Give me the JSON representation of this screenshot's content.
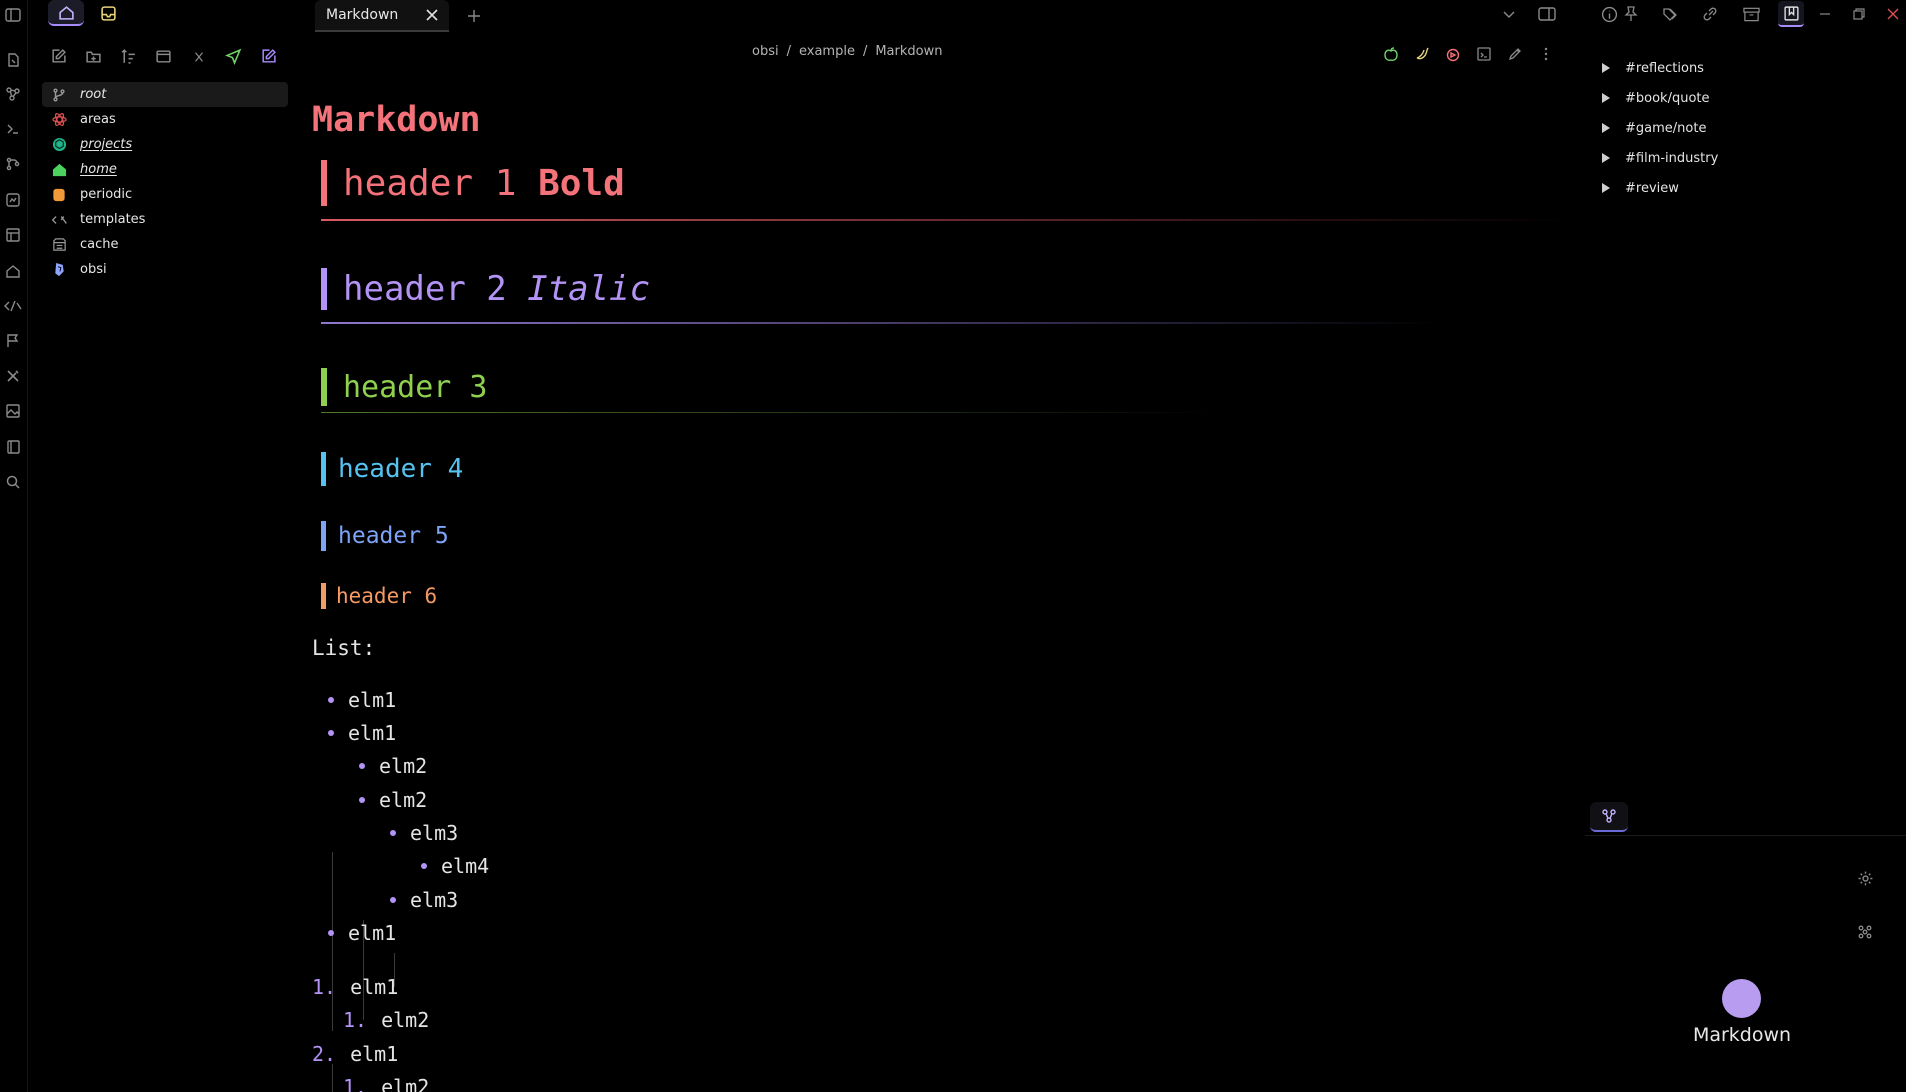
{
  "ribbon": {
    "icons": [
      "sidebar-toggle-icon",
      "open-quick-switcher-icon",
      "graph-view-icon",
      "terminal-icon",
      "git-icon",
      "canvas-icon",
      "templates-icon",
      "home-icon",
      "templater-icon",
      "flag-icon",
      "tools-icon",
      "image-icon",
      "book-icon",
      "search-icon"
    ]
  },
  "sidebar": {
    "tabs": [
      "home-icon",
      "inbox-icon"
    ],
    "toolbar": [
      "new-note-icon",
      "new-folder-icon",
      "sort-icon",
      "collapse-all-icon",
      "close-icon",
      "send-icon",
      "edit-note-icon"
    ],
    "tree": [
      {
        "label": "root",
        "icon": "git-branch-icon",
        "color": "#9a9a9a"
      },
      {
        "label": "areas",
        "icon": "atom-icon",
        "color": "#e0504f"
      },
      {
        "label": "projects",
        "icon": "cube-icon",
        "color": "#21b38a"
      },
      {
        "label": "home",
        "icon": "home-icon",
        "color": "#4cd35f"
      },
      {
        "label": "periodic",
        "icon": "calendar-icon",
        "color": "#f29a3a"
      },
      {
        "label": "templates",
        "icon": "code-icon",
        "color": "#9a9a9a"
      },
      {
        "label": "cache",
        "icon": "archive-icon",
        "color": "#9a9a9a"
      },
      {
        "label": "obsi",
        "icon": "obsidian-icon",
        "color": "#8ea4ff"
      }
    ]
  },
  "tabs": {
    "active_label": "Markdown",
    "close_label": "✕",
    "new_tab_label": "+"
  },
  "breadcrumb": {
    "parts": [
      "obsi",
      "/",
      "example",
      "/",
      "Markdown"
    ]
  },
  "note": {
    "title": "Markdown",
    "h1": {
      "text": "header 1 ",
      "bold": "Bold",
      "color": "#f4727a"
    },
    "h2": {
      "text": "header 2 ",
      "italic": "Italic",
      "color": "#b393f5"
    },
    "h3": {
      "text": "header 3",
      "color": "#8fd14f"
    },
    "h4": {
      "text": "header 4",
      "color": "#56c2f0"
    },
    "h5": {
      "text": "header 5",
      "color": "#7ea4f8"
    },
    "h6": {
      "text": "header 6",
      "color": "#f59a63"
    },
    "list_label": "List:",
    "ul": [
      {
        "text": "elm1",
        "depth": 0
      },
      {
        "text": "elm1",
        "depth": 0
      },
      {
        "text": "elm2",
        "depth": 1
      },
      {
        "text": "elm2",
        "depth": 1
      },
      {
        "text": "elm3",
        "depth": 2
      },
      {
        "text": "elm4",
        "depth": 3
      },
      {
        "text": "elm3",
        "depth": 2
      },
      {
        "text": "elm1",
        "depth": 0
      }
    ],
    "ol": [
      {
        "num": "1.",
        "text": "elm1",
        "depth": 0
      },
      {
        "num": "1.",
        "text": "elm2",
        "depth": 1
      },
      {
        "num": "2.",
        "text": "elm1",
        "depth": 0
      },
      {
        "num": "1.",
        "text": "elm2",
        "depth": 1
      }
    ]
  },
  "tags": [
    "#reflections",
    "#book/quote",
    "#game/note",
    "#film-industry",
    "#review"
  ],
  "graph": {
    "node_label": "Markdown",
    "node_color": "#b79cf0"
  }
}
